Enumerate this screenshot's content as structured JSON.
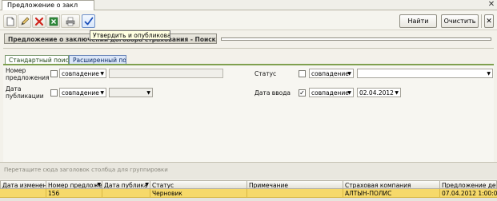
{
  "window": {
    "tab_title": "Предложение о закл",
    "tab_close": "✕"
  },
  "toolbar": {
    "find_label": "Найти",
    "clear_label": "Очистить",
    "tooltip": "Утвердить и опубликовать",
    "icons": [
      "new-doc-icon",
      "edit-icon",
      "delete-icon",
      "excel-icon",
      "print-icon",
      "approve-check-icon"
    ]
  },
  "panel": {
    "title": "Предложение о заключении договора страхования - Поиск"
  },
  "search_tabs": {
    "standard": "Стандартный поиск",
    "advanced": "Расширенный поиск"
  },
  "form": {
    "proposal_number_label": "Номер предложения",
    "publish_date_label": "Дата публикации",
    "status_label": "Статус",
    "input_date_label": "Дата ввода",
    "match_option": "совпадение",
    "input_date_value": "02.04.2012",
    "input_date_checked": "✓"
  },
  "grid": {
    "group_hint": "Перетащите сюда заголовок столбца для группировки",
    "columns": [
      "Дата изменения",
      "Номер предложения",
      "Дата публика",
      "Статус",
      "Примечание",
      "Страховая компания",
      "Предложение действ"
    ],
    "rows": [
      [
        "",
        "156",
        "",
        "Черновик",
        "",
        "АЛТЫН-ПОЛИС",
        "07.04.2012 1:00:00"
      ]
    ]
  },
  "colors": {
    "selected_row": "#f6d96a",
    "active_tab_border": "#7fa04f",
    "advanced_tab_bg": "#dbe6f8"
  }
}
